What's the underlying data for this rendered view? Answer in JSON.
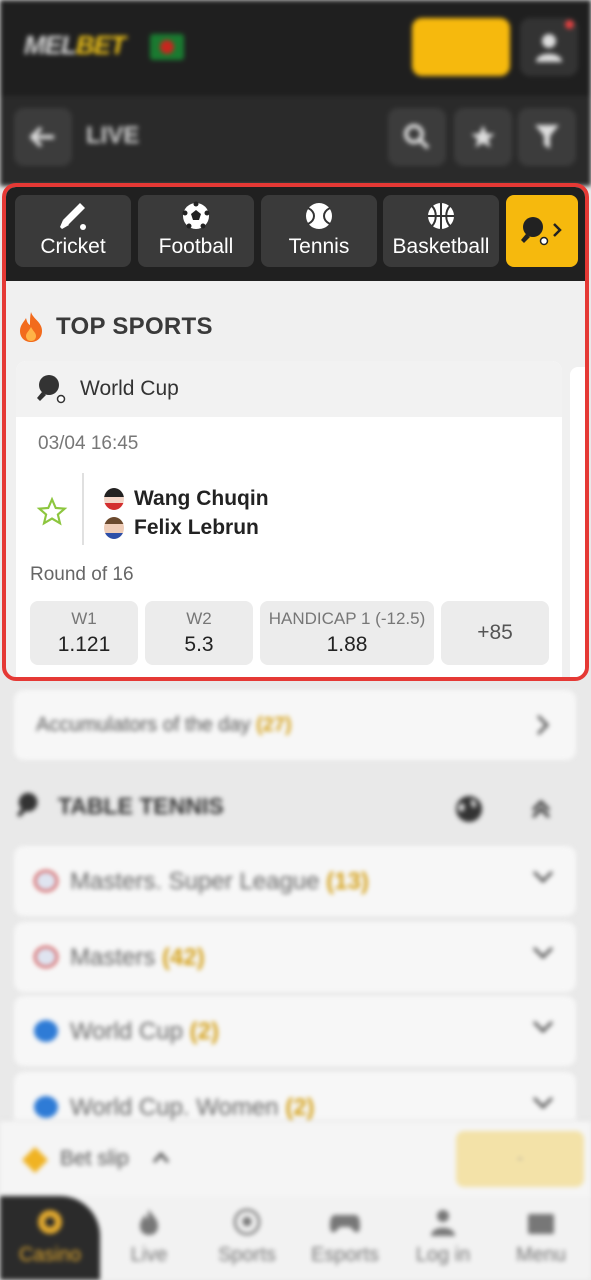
{
  "header": {
    "logo_left": "MEL",
    "logo_right": "BET",
    "live_title": "LIVE"
  },
  "sport_tabs": [
    {
      "label": "Cricket",
      "icon": "cricket-icon"
    },
    {
      "label": "Football",
      "icon": "football-icon"
    },
    {
      "label": "Tennis",
      "icon": "tennis-icon"
    },
    {
      "label": "Basketball",
      "icon": "basketball-icon"
    },
    {
      "label": "",
      "icon": "table-tennis-icon"
    }
  ],
  "top_sports": {
    "title": "TOP SPORTS",
    "card": {
      "competition": "World Cup",
      "datetime": "03/04 16:45",
      "players": [
        "Wang Chuqin",
        "Felix Lebrun"
      ],
      "round": "Round of 16",
      "odds": [
        {
          "label": "W1",
          "value": "1.121"
        },
        {
          "label": "W2",
          "value": "5.3"
        },
        {
          "label": "HANDICAP 1 (-12.5)",
          "value": "1.88"
        }
      ],
      "more": "+85"
    }
  },
  "accumulators": {
    "label": "Accumulators of the day ",
    "count": "(27)"
  },
  "table_tennis": {
    "title": "TABLE TENNIS",
    "leagues": [
      {
        "name": "Masters. Super League ",
        "count": "(13)"
      },
      {
        "name": "Masters ",
        "count": "(42)"
      },
      {
        "name": "World Cup ",
        "count": "(2)"
      },
      {
        "name": "World Cup. Women ",
        "count": "(2)"
      }
    ]
  },
  "bet_slip": {
    "label": "Bet slip",
    "marker": "-"
  },
  "bottom_nav": [
    {
      "label": "Casino",
      "icon": "casino-icon"
    },
    {
      "label": "Live",
      "icon": "flame-icon"
    },
    {
      "label": "Sports",
      "icon": "ball-icon"
    },
    {
      "label": "Esports",
      "icon": "gamepad-icon"
    },
    {
      "label": "Log in",
      "icon": "user-icon"
    },
    {
      "label": "Menu",
      "icon": "menu-icon"
    }
  ],
  "colors": {
    "accent": "#f6b90d",
    "highlight_border": "#e53935",
    "dark": "#202020"
  }
}
